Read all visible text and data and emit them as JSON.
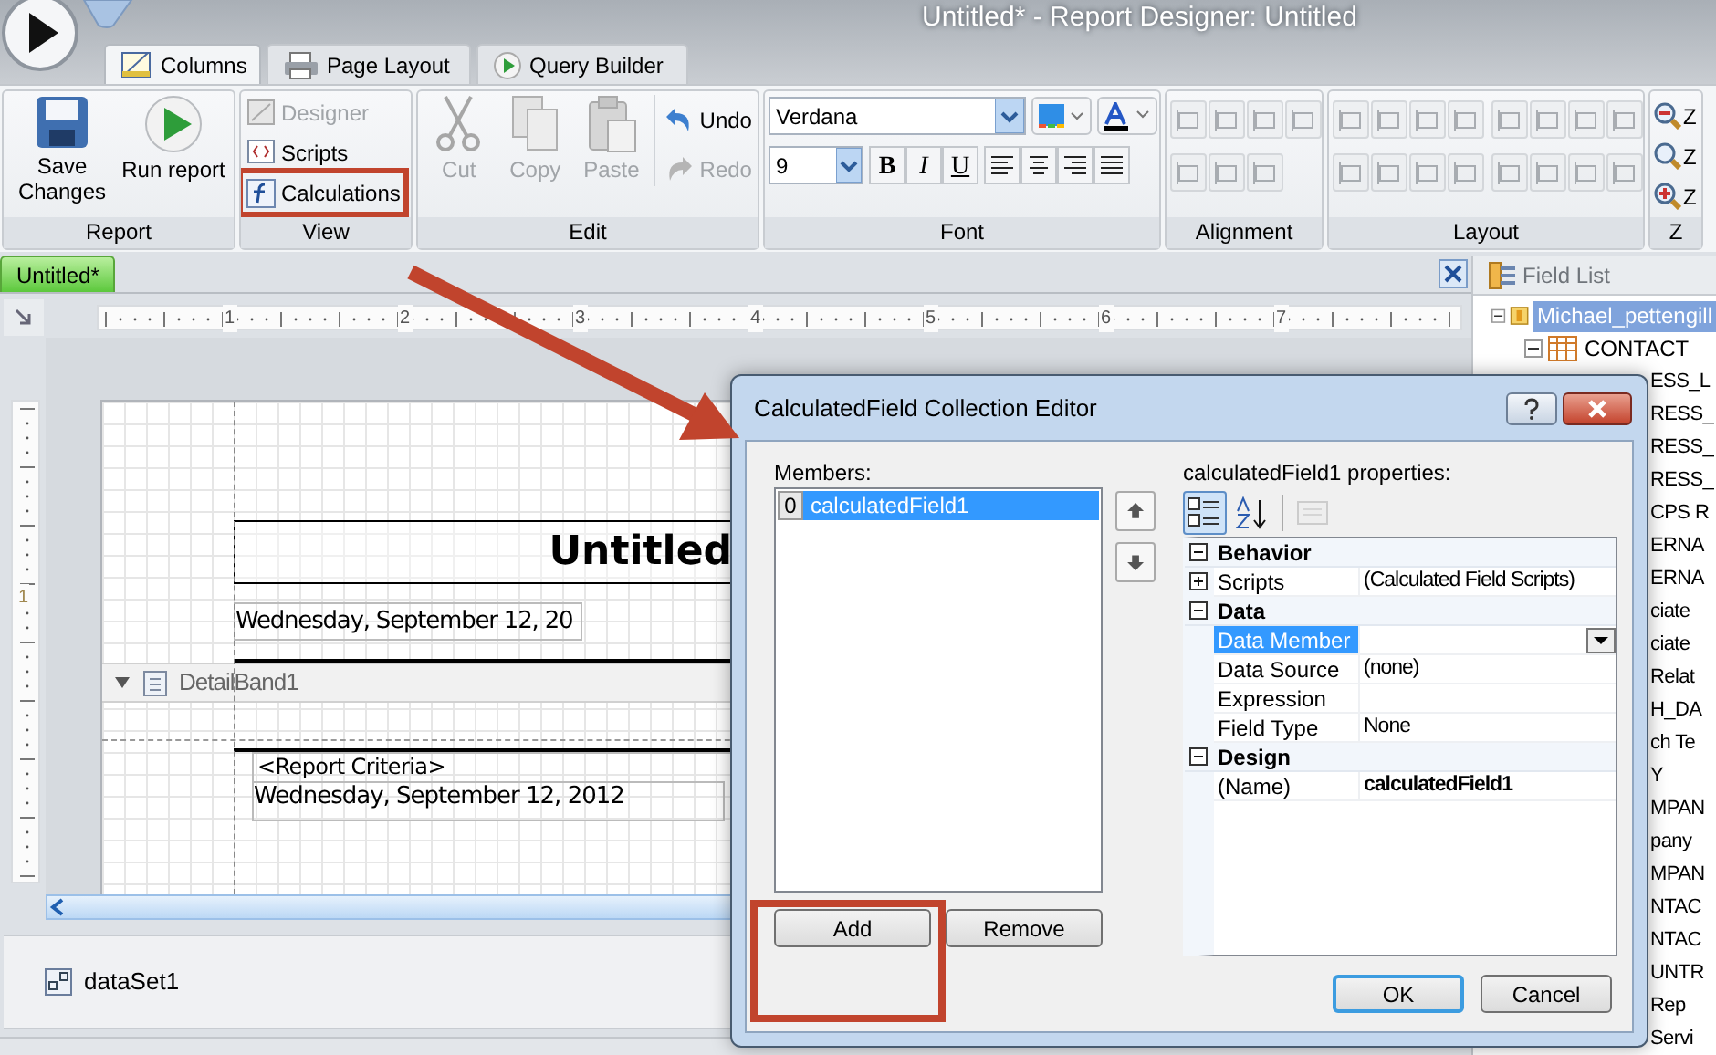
{
  "window": {
    "title": "Untitled* - Report Designer: Untitled"
  },
  "ribbon_tabs": [
    {
      "label": "Columns",
      "selected": true
    },
    {
      "label": "Page Layout",
      "selected": false
    },
    {
      "label": "Query Builder",
      "selected": false
    }
  ],
  "ribbon_groups": [
    {
      "kind": "commands",
      "label": "Report",
      "items": [
        {
          "kind": "large",
          "label": "Save Changes",
          "disabled": false
        },
        {
          "kind": "large",
          "label": "Run report",
          "disabled": false
        }
      ]
    },
    {
      "kind": "commands",
      "label": "View",
      "items": [
        {
          "kind": "small",
          "label": "Designer",
          "disabled": true
        },
        {
          "kind": "small",
          "label": "Scripts",
          "disabled": false
        },
        {
          "kind": "small",
          "label": "Calculations",
          "disabled": false
        }
      ]
    },
    {
      "kind": "commands",
      "label": "Edit",
      "items": [
        {
          "kind": "large",
          "label": "Cut",
          "disabled": true
        },
        {
          "kind": "large",
          "label": "Copy",
          "disabled": true
        },
        {
          "kind": "large",
          "label": "Paste",
          "disabled": true
        },
        {
          "kind": "small",
          "label": "Undo",
          "disabled": false
        },
        {
          "kind": "small",
          "label": "Redo",
          "disabled": true
        }
      ]
    },
    {
      "kind": "font",
      "label": "Font",
      "font_name": "Verdana",
      "font_size": "9",
      "styles": [
        "B",
        "I",
        "U"
      ]
    },
    {
      "kind": "icons",
      "label": "Alignment",
      "rows": [
        [
          {
            "disabled": true
          },
          {
            "disabled": true
          },
          {
            "disabled": true
          },
          {
            "disabled": true
          }
        ],
        [
          {
            "disabled": true
          },
          {
            "disabled": true
          },
          {
            "disabled": true
          }
        ]
      ]
    },
    {
      "kind": "icons",
      "label": "Layout",
      "rows": [
        [
          {
            "disabled": true
          },
          {
            "disabled": true
          },
          {
            "disabled": true
          },
          {
            "disabled": true
          },
          {
            "disabled": true
          },
          {
            "disabled": true
          },
          {
            "disabled": true
          },
          {
            "disabled": true
          }
        ],
        [
          {
            "disabled": true
          },
          {
            "disabled": true
          },
          {
            "disabled": true
          },
          {
            "disabled": true
          },
          {
            "disabled": true
          },
          {
            "disabled": true
          },
          {
            "disabled": true
          },
          {
            "disabled": true
          }
        ]
      ]
    },
    {
      "kind": "zoom",
      "label": "Z",
      "items": [
        "Z",
        "Z",
        "Z"
      ]
    }
  ],
  "document_tabs": [
    {
      "label": "Untitled*",
      "selected": true
    }
  ],
  "ruler": {
    "labels": [
      "1",
      "2",
      "3",
      "4",
      "5",
      "6",
      "7"
    ],
    "vertical_labels": [
      "1"
    ]
  },
  "report": {
    "title": "Untitled",
    "header_date": "Wednesday, September 12, 20",
    "band": "DetailBand1",
    "criteria": "<Report Criteria>",
    "detail_date": "Wednesday, September 12, 2012"
  },
  "component_tray": [
    {
      "label": "dataSet1"
    }
  ],
  "field_list": {
    "title": "Field List",
    "tree": [
      {
        "label": "Michael_pettengill",
        "selected": true,
        "expanded": true,
        "children": [
          {
            "label": "CONTACT",
            "selected": false,
            "expanded": true,
            "children": [
              {
                "label": "ESS_L"
              },
              {
                "label": "RESS_"
              },
              {
                "label": "RESS_"
              },
              {
                "label": "RESS_"
              },
              {
                "label": "CPS R"
              },
              {
                "label": "ERNA"
              },
              {
                "label": "ERNA"
              },
              {
                "label": "ciate"
              },
              {
                "label": "ciate"
              },
              {
                "label": "Relat"
              },
              {
                "label": "H_DA"
              },
              {
                "label": "ch Te"
              },
              {
                "label": "Y"
              },
              {
                "label": "MPAN"
              },
              {
                "label": "pany"
              },
              {
                "label": "MPAN"
              },
              {
                "label": "NTAC"
              },
              {
                "label": "NTAC"
              },
              {
                "label": "UNTR"
              },
              {
                "label": "Rep"
              },
              {
                "label": "Servi"
              }
            ]
          }
        ]
      }
    ]
  },
  "dialog": {
    "title": "CalculatedField Collection Editor",
    "members_label": "Members:",
    "members": [
      {
        "index": "0",
        "name": "calculatedField1",
        "selected": true
      }
    ],
    "properties_label": "calculatedField1 properties:",
    "toolbar": [
      {
        "selected": true,
        "disabled": false
      },
      {
        "selected": false,
        "disabled": false
      },
      {
        "selected": false,
        "disabled": true
      }
    ],
    "categories": [
      {
        "name": "Behavior",
        "expanded": true,
        "properties": [
          {
            "name": "Scripts",
            "value": "(Calculated Field Scripts)",
            "expandable": true,
            "selected": false
          }
        ]
      },
      {
        "name": "Data",
        "expanded": true,
        "properties": [
          {
            "name": "Data Member",
            "selected": true,
            "dropdown": true
          },
          {
            "name": "Data Source",
            "value": "(none)",
            "selected": false
          },
          {
            "name": "Expression",
            "selected": false
          },
          {
            "name": "Field Type",
            "value": "None",
            "selected": false,
            "bold": false
          }
        ]
      },
      {
        "name": "Design",
        "expanded": true,
        "properties": [
          {
            "name": "(Name)",
            "value": "calculatedField1",
            "selected": false,
            "bold": true
          }
        ]
      }
    ],
    "list_buttons": [
      "Add",
      "Remove"
    ],
    "buttons": [
      {
        "label": "OK",
        "default": true
      },
      {
        "label": "Cancel",
        "default": false
      }
    ]
  }
}
